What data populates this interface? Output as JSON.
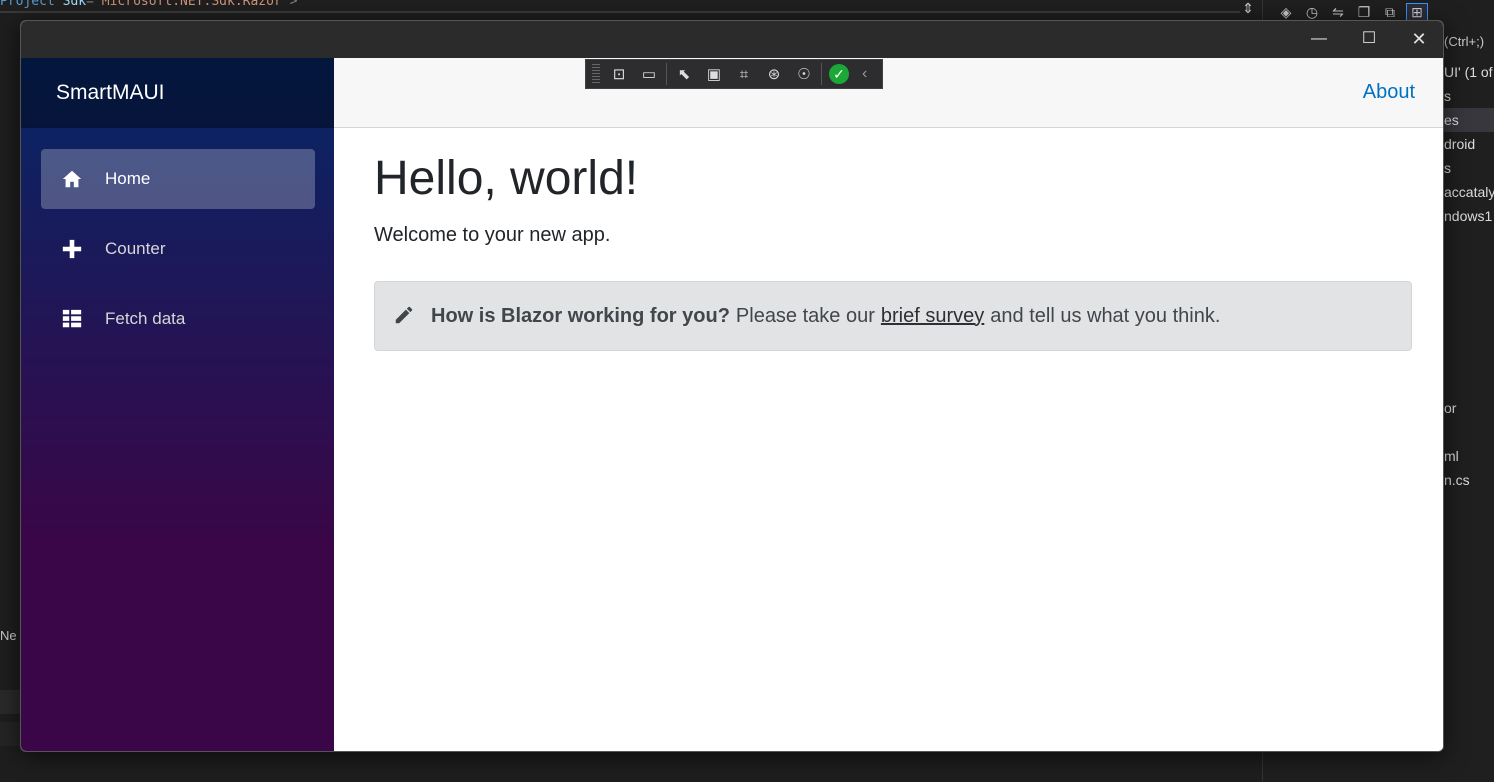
{
  "ide": {
    "code_line": {
      "tag": "Project",
      "attr": "Sdk",
      "value": "\"Microsoft.NET.Sdk.Razor\"",
      "close": ">"
    },
    "search_hint": "(Ctrl+;)",
    "solution_hint": "UI' (1 of",
    "tree_items": [
      "s",
      "es",
      "droid",
      "s",
      "accataly",
      "ndows1",
      "or",
      "ml",
      "n.cs"
    ],
    "bottom_label": "Ne"
  },
  "window": {
    "minimize_label": "—",
    "maximize_label": "☐",
    "close_label": "✕"
  },
  "app": {
    "brand": "SmartMAUI",
    "nav": [
      {
        "label": "Home",
        "icon": "home-icon",
        "active": true
      },
      {
        "label": "Counter",
        "icon": "plus-icon",
        "active": false
      },
      {
        "label": "Fetch data",
        "icon": "list-icon",
        "active": false
      }
    ],
    "about_link": "About",
    "heading": "Hello, world!",
    "welcome": "Welcome to your new app.",
    "survey": {
      "icon": "pencil-icon",
      "question": "How is Blazor working for you?",
      "before_link": "Please take our",
      "link_text": "brief survey",
      "after_link": "and tell us what you think."
    }
  },
  "debug_toolbar": {
    "icons": [
      "live-visual-tree-icon",
      "record-icon",
      "select-element-icon",
      "display-adorners-icon",
      "track-focus-icon",
      "binding-failures-icon",
      "accessibility-icon",
      "scan-ok-icon",
      "collapse-toolbar-icon"
    ]
  }
}
